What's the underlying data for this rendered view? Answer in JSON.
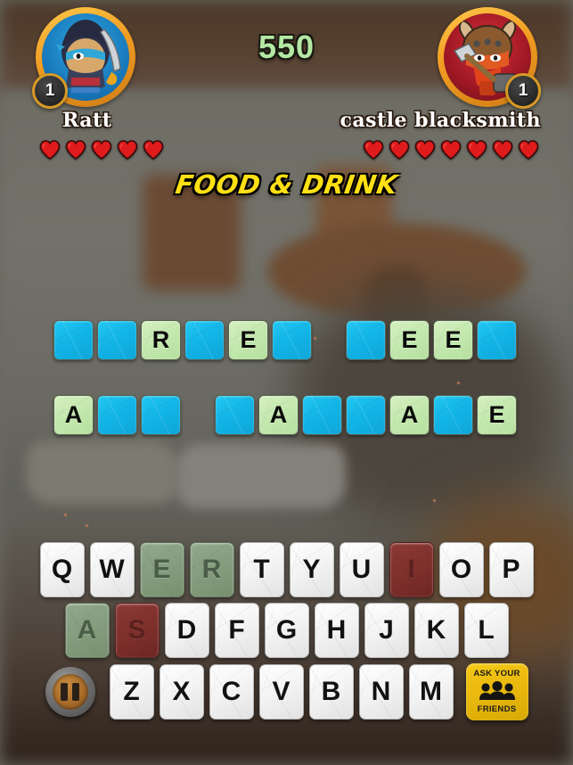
{
  "header": {
    "score": "550",
    "players": [
      {
        "name": "Ratt",
        "level": "1",
        "hearts": 5,
        "avatar_bg": "#1b7ec0",
        "side": "left"
      },
      {
        "name": "castle blacksmith",
        "level": "1",
        "hearts": 7,
        "avatar_bg": "#9e1824",
        "side": "right"
      }
    ]
  },
  "category": "FOOD & DRINK",
  "puzzle": {
    "rows": [
      {
        "groups": [
          {
            "tiles": [
              {
                "letter": "",
                "state": "blank"
              },
              {
                "letter": "",
                "state": "blank"
              },
              {
                "letter": "R",
                "state": "filled"
              },
              {
                "letter": "",
                "state": "blank"
              },
              {
                "letter": "E",
                "state": "filled"
              },
              {
                "letter": "",
                "state": "blank"
              }
            ]
          },
          {
            "tiles": [
              {
                "letter": "",
                "state": "blank"
              },
              {
                "letter": "E",
                "state": "filled"
              },
              {
                "letter": "E",
                "state": "filled"
              },
              {
                "letter": "",
                "state": "blank"
              }
            ]
          }
        ]
      },
      {
        "groups": [
          {
            "tiles": [
              {
                "letter": "A",
                "state": "filled"
              },
              {
                "letter": "",
                "state": "blank"
              },
              {
                "letter": "",
                "state": "blank"
              }
            ]
          },
          {
            "tiles": [
              {
                "letter": "",
                "state": "blank"
              },
              {
                "letter": "A",
                "state": "filled"
              },
              {
                "letter": "",
                "state": "blank"
              },
              {
                "letter": "",
                "state": "blank"
              },
              {
                "letter": "A",
                "state": "filled"
              },
              {
                "letter": "",
                "state": "blank"
              },
              {
                "letter": "E",
                "state": "filled"
              }
            ]
          }
        ]
      }
    ]
  },
  "keyboard": {
    "rows": [
      [
        {
          "key": "Q",
          "state": "available"
        },
        {
          "key": "W",
          "state": "available"
        },
        {
          "key": "E",
          "state": "correct"
        },
        {
          "key": "R",
          "state": "correct"
        },
        {
          "key": "T",
          "state": "available"
        },
        {
          "key": "Y",
          "state": "available"
        },
        {
          "key": "U",
          "state": "available"
        },
        {
          "key": "I",
          "state": "wrong"
        },
        {
          "key": "O",
          "state": "available"
        },
        {
          "key": "P",
          "state": "available"
        }
      ],
      [
        {
          "key": "A",
          "state": "correct"
        },
        {
          "key": "S",
          "state": "wrong"
        },
        {
          "key": "D",
          "state": "available"
        },
        {
          "key": "F",
          "state": "available"
        },
        {
          "key": "G",
          "state": "available"
        },
        {
          "key": "H",
          "state": "available"
        },
        {
          "key": "J",
          "state": "available"
        },
        {
          "key": "K",
          "state": "available"
        },
        {
          "key": "L",
          "state": "available"
        }
      ],
      [
        {
          "key": "Z",
          "state": "available"
        },
        {
          "key": "X",
          "state": "available"
        },
        {
          "key": "C",
          "state": "available"
        },
        {
          "key": "V",
          "state": "available"
        },
        {
          "key": "B",
          "state": "available"
        },
        {
          "key": "N",
          "state": "available"
        },
        {
          "key": "M",
          "state": "available"
        }
      ]
    ]
  },
  "controls": {
    "pause_icon": "pause-icon",
    "ask_line1": "ASK YOUR",
    "ask_line2": "FRIENDS",
    "ask_icon": "three-people-icon"
  },
  "colors": {
    "tile_blank": "#12b4e6",
    "tile_filled": "#c3e8ae",
    "key_correct": "#859c7e",
    "key_wrong": "#7e302c",
    "score_text": "#b4e8a4",
    "category_text": "#ffe014",
    "ask_button": "#e8b80d",
    "avatar_ring": "#f09c22",
    "heart": "#e01b1b"
  }
}
